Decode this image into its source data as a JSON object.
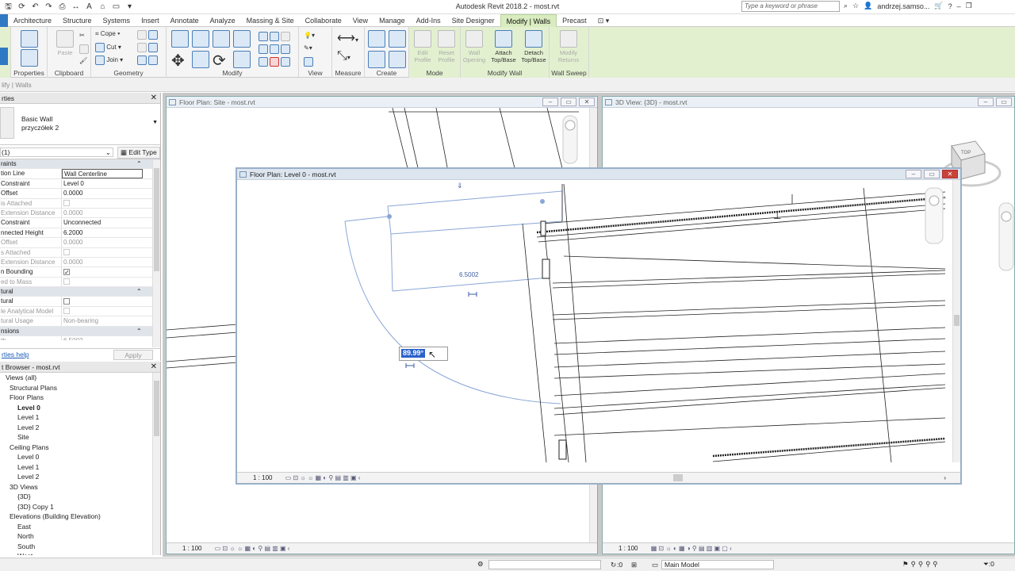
{
  "app": {
    "title": "Autodesk Revit 2018.2 -   most.rvt",
    "search_placeholder": "Type a keyword or phrase",
    "user": "andrzej.samso...",
    "help": "?"
  },
  "ribbon_tabs": [
    "Architecture",
    "Structure",
    "Systems",
    "Insert",
    "Annotate",
    "Analyze",
    "Massing & Site",
    "Collaborate",
    "View",
    "Manage",
    "Add-Ins",
    "Site Designer",
    "Modify | Walls",
    "Precast"
  ],
  "ribbon": {
    "properties_label": "Properties",
    "clipboard": {
      "label": "Clipboard",
      "paste": "Paste"
    },
    "geometry": {
      "label": "Geometry",
      "cope": "Cope",
      "cut": "Cut",
      "join": "Join"
    },
    "modify": {
      "label": "Modify"
    },
    "view": {
      "label": "View"
    },
    "measure": {
      "label": "Measure"
    },
    "create": {
      "label": "Create"
    },
    "mode": {
      "label": "Mode",
      "edit_profile": "Edit Profile",
      "reset_profile": "Reset Profile"
    },
    "modify_wall": {
      "label": "Modify Wall",
      "wall_opening": "Wall Opening",
      "attach": "Attach Top/Base",
      "detach": "Detach Top/Base"
    },
    "wall_sweep": {
      "label": "Wall Sweep",
      "modify_returns": "Modify Returns"
    }
  },
  "options_bar": {
    "text": "lify | Walls"
  },
  "properties": {
    "header": "rties",
    "type_name": "Basic Wall",
    "type_subname": "przyczółek 2",
    "filter": "(1)",
    "edit_type": "Edit Type",
    "help_link": "rties help",
    "apply": "Apply",
    "rows": [
      {
        "k": "raints",
        "v": "",
        "group": true
      },
      {
        "k": "tion Line",
        "v": "Wall Centerline",
        "boxed": true
      },
      {
        "k": "Constraint",
        "v": "Level 0"
      },
      {
        "k": "Offset",
        "v": "0.0000"
      },
      {
        "k": "is Attached",
        "v": "",
        "check": "off",
        "dis": true
      },
      {
        "k": "Extension Distance",
        "v": "0.0000",
        "dis": true
      },
      {
        "k": "Constraint",
        "v": "Unconnected"
      },
      {
        "k": "nnected Height",
        "v": "6.2000"
      },
      {
        "k": "Offset",
        "v": "0.0000",
        "dis": true
      },
      {
        "k": "s Attached",
        "v": "",
        "check": "off",
        "dis": true
      },
      {
        "k": "Extension Distance",
        "v": "0.0000",
        "dis": true
      },
      {
        "k": "n Bounding",
        "v": "",
        "check": "on"
      },
      {
        "k": "ed to Mass",
        "v": "",
        "check": "off",
        "dis": true
      },
      {
        "k": "tural",
        "v": "",
        "group": true
      },
      {
        "k": "tural",
        "v": "",
        "check": "off"
      },
      {
        "k": "le Analytical Model",
        "v": "",
        "check": "off",
        "dis": true
      },
      {
        "k": "tural Usage",
        "v": "Non-bearing",
        "dis": true
      },
      {
        "k": "nsions",
        "v": "",
        "group": true
      },
      {
        "k": "th",
        "v": "6.5002",
        "dis": true
      }
    ]
  },
  "browser": {
    "header": "t Browser - most.rvt",
    "items": [
      {
        "text": "Views (all)",
        "indent": 1
      },
      {
        "text": "Structural Plans",
        "indent": 2
      },
      {
        "text": "Floor Plans",
        "indent": 2
      },
      {
        "text": "Level 0",
        "indent": 4,
        "selected": true
      },
      {
        "text": "Level 1",
        "indent": 4
      },
      {
        "text": "Level 2",
        "indent": 4
      },
      {
        "text": "Site",
        "indent": 4
      },
      {
        "text": "Ceiling Plans",
        "indent": 2
      },
      {
        "text": "Level 0",
        "indent": 4
      },
      {
        "text": "Level 1",
        "indent": 4
      },
      {
        "text": "Level 2",
        "indent": 4
      },
      {
        "text": "3D Views",
        "indent": 2
      },
      {
        "text": "{3D}",
        "indent": 4
      },
      {
        "text": "{3D} Copy 1",
        "indent": 4
      },
      {
        "text": "Elevations (Building Elevation)",
        "indent": 2
      },
      {
        "text": "East",
        "indent": 4
      },
      {
        "text": "North",
        "indent": 4
      },
      {
        "text": "South",
        "indent": 4
      },
      {
        "text": "West",
        "indent": 4
      }
    ]
  },
  "views": {
    "site": {
      "title": "Floor Plan: Site - most.rvt",
      "scale": "1 : 100"
    },
    "threed": {
      "title": "3D View: {3D} - most.rvt",
      "scale": "1 : 100",
      "cube_top": "TOP"
    },
    "level0": {
      "title": "Floor Plan: Level 0 - most.rvt",
      "scale": "1 : 100",
      "dimension": "6.5002",
      "angle_value": "89.99°"
    }
  },
  "statusbar": {
    "zero": ":0",
    "model": "Main Model"
  },
  "colors": {
    "accent": "#2f78c4",
    "contextual_tab": "#d9ecc0",
    "sketch_line": "#8aa6d6"
  }
}
